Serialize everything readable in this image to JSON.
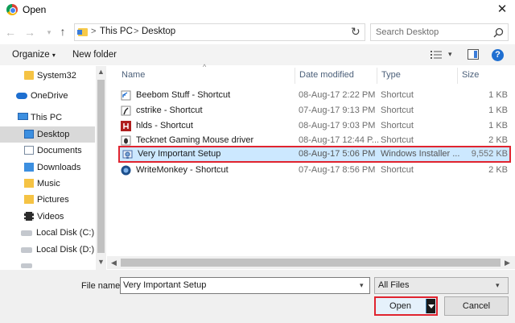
{
  "window": {
    "title": "Open",
    "close_label": "✕"
  },
  "address_bar": {
    "crumbs": [
      "This PC",
      "Desktop"
    ],
    "separator": ">"
  },
  "search": {
    "placeholder": "Search Desktop"
  },
  "toolbar": {
    "organize_label": "Organize",
    "new_folder_label": "New folder"
  },
  "sidebar": {
    "items": [
      {
        "label": "System32",
        "icon": "folder-icon"
      },
      {
        "label": "OneDrive",
        "icon": "onedrive-icon"
      },
      {
        "label": "This PC",
        "icon": "this-pc-icon"
      },
      {
        "label": "Desktop",
        "icon": "desktop-folder-icon",
        "selected": true
      },
      {
        "label": "Documents",
        "icon": "documents-icon"
      },
      {
        "label": "Downloads",
        "icon": "downloads-icon"
      },
      {
        "label": "Music",
        "icon": "music-icon"
      },
      {
        "label": "Pictures",
        "icon": "pictures-icon"
      },
      {
        "label": "Videos",
        "icon": "videos-icon"
      },
      {
        "label": "Local Disk (C:)",
        "icon": "disk-icon"
      },
      {
        "label": "Local Disk (D:)",
        "icon": "disk-icon"
      }
    ]
  },
  "columns": {
    "name": "Name",
    "date": "Date modified",
    "type": "Type",
    "size": "Size"
  },
  "files": [
    {
      "name": "Beebom Stuff - Shortcut",
      "date": "08-Aug-17 2:22 PM",
      "type": "Shortcut",
      "size": "1 KB",
      "icon": "shortcut-icon",
      "selected": false
    },
    {
      "name": "cstrike - Shortcut",
      "date": "07-Aug-17 9:13 PM",
      "type": "Shortcut",
      "size": "1 KB",
      "icon": "cstrike-icon",
      "selected": false
    },
    {
      "name": "hlds - Shortcut",
      "date": "08-Aug-17 9:03 PM",
      "type": "Shortcut",
      "size": "1 KB",
      "icon": "hlds-icon",
      "selected": false
    },
    {
      "name": "Tecknet Gaming Mouse driver",
      "date": "08-Aug-17 12:44 P...",
      "type": "Shortcut",
      "size": "2 KB",
      "icon": "mouse-driver-icon",
      "selected": false
    },
    {
      "name": "Very Important Setup",
      "date": "08-Aug-17 5:06 PM",
      "type": "Windows Installer ...",
      "size": "9,552 KB",
      "icon": "installer-icon",
      "selected": true
    },
    {
      "name": "WriteMonkey - Shortcut",
      "date": "07-Aug-17 8:56 PM",
      "type": "Shortcut",
      "size": "2 KB",
      "icon": "writemonkey-icon",
      "selected": false
    }
  ],
  "file_name": {
    "label": "File name:",
    "value": "Very Important Setup"
  },
  "file_type": {
    "value": "All Files"
  },
  "buttons": {
    "open_label": "Open",
    "cancel_label": "Cancel"
  },
  "colors": {
    "selection": "#cce8ff",
    "highlight_border": "#e0242f",
    "accent": "#1f6fd1"
  }
}
